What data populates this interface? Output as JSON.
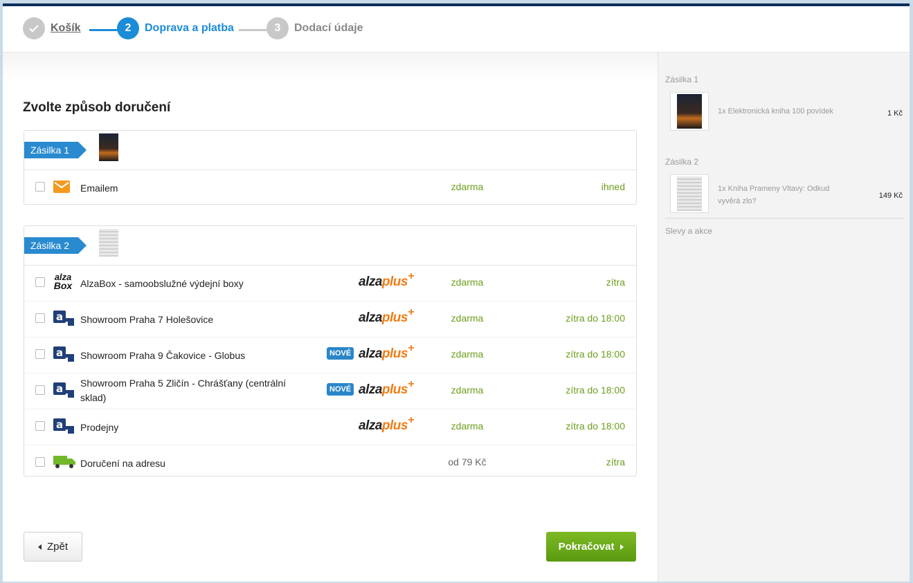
{
  "stepper": {
    "steps": [
      {
        "num": "✓",
        "label": "Košík"
      },
      {
        "num": "2",
        "label": "Doprava a platba"
      },
      {
        "num": "3",
        "label": "Dodací údaje"
      }
    ]
  },
  "main": {
    "title": "Zvolte způsob doručení",
    "shipments": [
      {
        "tag": "Zásilka 1",
        "options": [
          {
            "name": "Emailem",
            "price": "zdarma",
            "when": "ihned",
            "icon": "email-icon"
          }
        ]
      },
      {
        "tag": "Zásilka 2",
        "options": [
          {
            "name": "AlzaBox - samoobslužné výdejní boxy",
            "alzaplus": true,
            "price": "zdarma",
            "when": "zítra",
            "icon": "alzabox-icon"
          },
          {
            "name": "Showroom Praha 7 Holešovice",
            "alzaplus": true,
            "price": "zdarma",
            "when": "zítra do 18:00",
            "icon": "showroom-icon"
          },
          {
            "name": "Showroom Praha 9 Čakovice - Globus",
            "nove": "NOVÉ",
            "alzaplus": true,
            "price": "zdarma",
            "when": "zítra do 18:00",
            "icon": "showroom-icon"
          },
          {
            "name": "Showroom Praha 5 Zličín - Chrášťany (centrální sklad)",
            "nove": "NOVÉ",
            "alzaplus": true,
            "price": "zdarma",
            "when": "zítra do 18:00",
            "icon": "showroom-icon"
          },
          {
            "name": "Prodejny",
            "alzaplus": true,
            "price": "zdarma",
            "when": "zítra do 18:00",
            "icon": "showroom-icon"
          },
          {
            "name": "Doručení na adresu",
            "price": "od 79 Kč",
            "when": "zítra",
            "icon": "delivery-truck-icon"
          }
        ]
      }
    ],
    "alzaplus": {
      "part1": "alza",
      "part2": "plus",
      "plus": "+"
    },
    "alzabox_logo": {
      "line1": "alza",
      "line2": "Box"
    },
    "back_label": "Zpět",
    "continue_label": "Pokračovat"
  },
  "sidebar": {
    "shipments": [
      {
        "label": "Zásilka 1",
        "item": "1x Elektronická kniha 100 povídek",
        "price": "1 Kč"
      },
      {
        "label": "Zásilka 2",
        "item": "1x Kniha Prameny Vltavy: Odkud vyvěrá zlo?",
        "price": "149 Kč"
      }
    ],
    "discounts_label": "Slevy a akce"
  },
  "colors": {
    "accent": "#1a8cd8",
    "green": "#6b9e1c",
    "orange": "#f07d14",
    "navy": "#0b2f5a"
  }
}
